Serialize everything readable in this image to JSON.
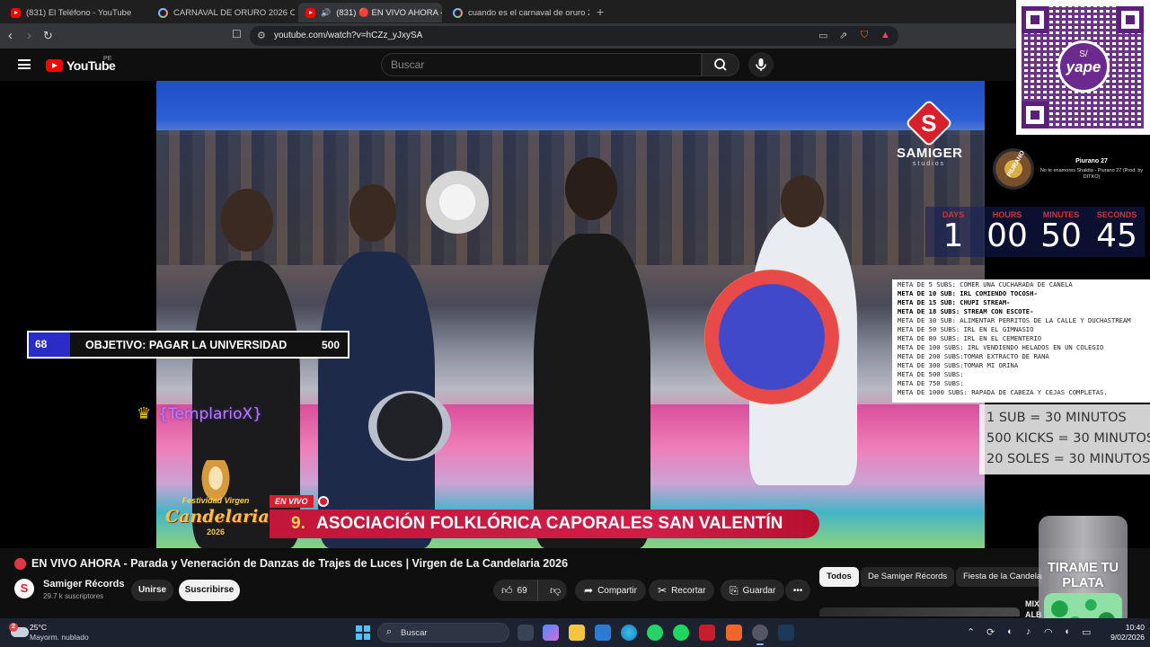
{
  "browser": {
    "tabs": [
      {
        "title": "(831) El Teléfono - YouTube",
        "favicon": "youtube-icon"
      },
      {
        "title": "CARNAVAL DE ORURO 2026 CUANDO",
        "favicon": "google-icon"
      },
      {
        "title": "(831) 🔴 EN VIVO AHORA - P",
        "favicon": "youtube-icon",
        "active": true
      },
      {
        "title": "cuando es el carnaval de oruro 2026",
        "favicon": "google-icon"
      }
    ],
    "new_tab": "+",
    "url": "youtube.com/watch?v=hCZz_yJxySA"
  },
  "youtube": {
    "logo_text": "YouTube",
    "country": "PE",
    "search_placeholder": "Buscar"
  },
  "stream_overlay": {
    "brand": {
      "letter": "S",
      "name": "SAMIGER",
      "sub": "studios"
    },
    "now_playing": {
      "art_text": "PIURANO",
      "title": "Piurano 27",
      "subtitle": "No te enamores Shakita - Piurano 27 (Prod. by DITKO)"
    },
    "timer": {
      "labels": [
        "DAYS",
        "HOURS",
        "MINUTES",
        "SECONDS"
      ],
      "values": [
        "1",
        "00",
        "50",
        "45"
      ],
      "label_color": "#d13434"
    },
    "goals": [
      {
        "text": "META DE 5 SUBS: COMER UNA CUCHARADA DE CANELA",
        "bold": false
      },
      {
        "text": "META DE 10 SUB: IRL COMIENDO TOCOSH-",
        "bold": true
      },
      {
        "text": "META DE 15 SUB: CHUPI STREAM-",
        "bold": true
      },
      {
        "text": "META DE 18 SUBS: STREAM CON ESCOTE-",
        "bold": true
      },
      {
        "text": "META DE 30 SUB:  ALIMENTAR PERRITOS DE LA CALLE Y DUCHASTREAM",
        "bold": false
      },
      {
        "text": "META DE 50 SUBS: IRL EN EL GIMNASIO",
        "bold": false
      },
      {
        "text": "META DE 80 SUBS: IRL EN EL CEMENTERIO",
        "bold": false
      },
      {
        "text": "META DE 100 SUBS: IRL VENDIENDO HELADOS EN UN COLEGIO",
        "bold": false
      },
      {
        "text": "META DE 200 SUBS:TOMAR EXTRACTO DE RANA",
        "bold": false
      },
      {
        "text": "META DE 300 SUBS:TOMAR MI ORINA",
        "bold": false
      },
      {
        "text": "META DE 500 SUBS:",
        "bold": false
      },
      {
        "text": "META DE 750 SUBS:",
        "bold": false
      },
      {
        "text": "META DE 1000 SUBS: RAPADA DE CABEZA Y CEJAS COMPLETAS.",
        "bold": false
      }
    ],
    "rates": [
      "1 SUB = 30 MINUTOS",
      "500 KICKS = 30 MINUTOS",
      "20 SOLES = 30 MINUTOS"
    ],
    "objective": {
      "current": "68",
      "label": "OBJETIVO: PAGAR LA UNIVERSIDAD",
      "target": "500",
      "progress": 0.136
    },
    "member": "{TemplarioX}",
    "festival": {
      "line1": "Festividad Virgen",
      "line2": "Candelaria",
      "line3": "2026"
    },
    "live_tag": "EN VIVO",
    "lower_third": {
      "number": "9.",
      "text": "ASOCIACIÓN FOLKLÓRICA CAPORALES SAN VALENTÍN"
    },
    "yape": {
      "symbol": "S/",
      "name": "yape"
    },
    "jar_text": "TIRAME TU PLATA"
  },
  "video": {
    "title": "EN VIVO AHORA - Parada y Veneración de Danzas de Trajes de Luces | Virgen de La Candelaria 2026",
    "channel": {
      "avatar": "S",
      "name": "Samiger Récords",
      "subs": "29.7 k suscriptores"
    },
    "join_label": "Unirse",
    "subscribe_label": "Suscribirse",
    "likes": "69",
    "share_label": "Compartir",
    "clip_label": "Recortar",
    "save_label": "Guardar",
    "more_label": "•••"
  },
  "chips": [
    "Todos",
    "De Samiger Récords",
    "Fiesta de la Candelaria"
  ],
  "sidebar_mix": {
    "line1": "MIX",
    "line2": "ALB"
  },
  "taskbar": {
    "weather_badge": "2",
    "temperature": "25°C",
    "weather_desc": "Mayorm. nublado",
    "search_label": "Buscar",
    "time": "10:40",
    "date": "9/02/2026"
  }
}
